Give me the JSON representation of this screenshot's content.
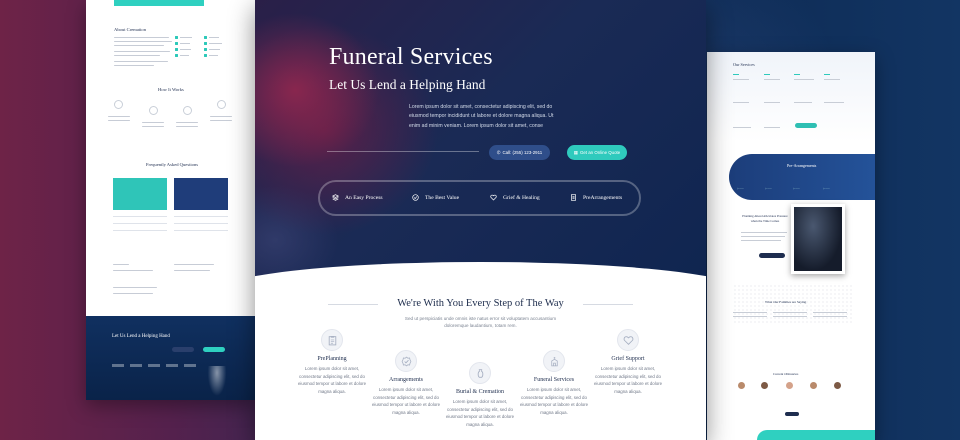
{
  "hero": {
    "title": "Funeral Services",
    "subtitle": "Let Us Lend a Helping Hand",
    "lead": "Lorem ipsum dolor sit amet, consectetur adipiscing elit, sed do eiusmod tempor incididunt ut labore et dolore magna aliqua. Ut enim ad minim veniam. Lorem ipsum dolor sit amet, conse",
    "call_button": "Call: (255) 123-2911",
    "quote_button": "Get an Online Quote"
  },
  "features": [
    {
      "label": "An Easy Process",
      "icon": "layers-icon"
    },
    {
      "label": "The Best Value",
      "icon": "check-circle-icon"
    },
    {
      "label": "Grief & Healing",
      "icon": "heart-icon"
    },
    {
      "label": "PreArrangements",
      "icon": "document-icon"
    }
  ],
  "section": {
    "title": "We're With You Every Step of The Way",
    "subtitle": "Sed ut perspiciatis unde omnis iste natus error sit voluptatem accusantium doloremque laudantium, totam rem."
  },
  "services": [
    {
      "name": "PrePlanning",
      "icon": "clipboard-icon",
      "desc": "Lorem ipsum dolor sit amet, consectetur adipiscing elit, sed do eiusmod tempor ut labore et dolore magna aliqua."
    },
    {
      "name": "Arrangements",
      "icon": "badge-check-icon",
      "desc": "Lorem ipsum dolor sit amet, consectetur adipiscing elit, sed do eiusmod tempor ut labore et dolore magna aliqua."
    },
    {
      "name": "Burial & Cremation",
      "icon": "urn-icon",
      "desc": "Lorem ipsum dolor sit amet, consectetur adipiscing elit, sed do eiusmod tempor ut labore et dolore magna aliqua."
    },
    {
      "name": "Funeral Services",
      "icon": "building-icon",
      "desc": "Lorem ipsum dolor sit amet, consectetur adipiscing elit, sed do eiusmod tempor ut labore et dolore magna aliqua."
    },
    {
      "name": "Grief Support",
      "icon": "heart-icon",
      "desc": "Lorem ipsum dolor sit amet, consectetur adipiscing elit, sed do eiusmod tempor ut labore et dolore magna aliqua."
    }
  ],
  "left_page": {
    "about_title": "About Cremation",
    "how_title": "How It Works",
    "faq_title": "Frequently Asked Questions",
    "footer_title": "Let Us Lend a Helping Hand"
  },
  "right_page": {
    "services_title": "Our Services",
    "prearrangements_title": "Pre-Arrangements",
    "planning_title": "Planning Ahead Alleviates Pressure when the Time Comes",
    "reviews_title": "What Our Families are Saying",
    "obituaries_title": "Current Obituaries"
  },
  "colors": {
    "accent": "#2fcabd",
    "navy": "#1d2c4c",
    "call_button": "#2f4e8a"
  }
}
